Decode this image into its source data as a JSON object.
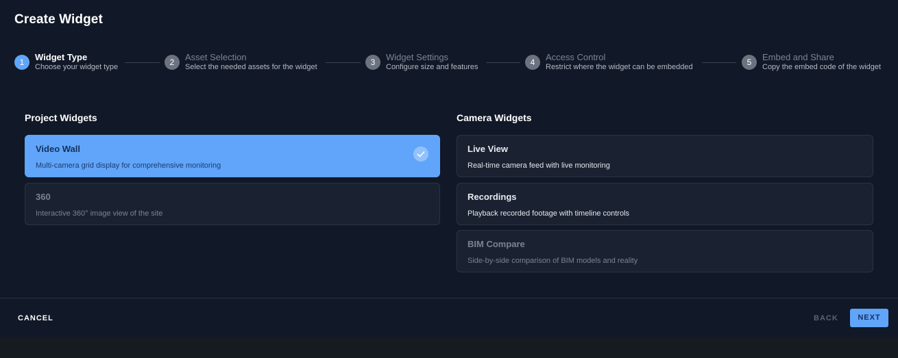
{
  "dialog": {
    "title": "Create Widget"
  },
  "stepper": {
    "steps": [
      {
        "number": "1",
        "title": "Widget Type",
        "subtitle": "Choose your widget type",
        "active": true
      },
      {
        "number": "2",
        "title": "Asset Selection",
        "subtitle": "Select the needed assets for the widget",
        "active": false
      },
      {
        "number": "3",
        "title": "Widget Settings",
        "subtitle": "Configure size and features",
        "active": false
      },
      {
        "number": "4",
        "title": "Access Control",
        "subtitle": "Restrict where the widget can be embedded",
        "active": false
      },
      {
        "number": "5",
        "title": "Embed and Share",
        "subtitle": "Copy the embed code of the widget",
        "active": false
      }
    ]
  },
  "project_widgets": {
    "heading": "Project Widgets",
    "cards": [
      {
        "title": "Video Wall",
        "description": "Multi-camera grid display for comprehensive monitoring",
        "state": "selected"
      },
      {
        "title": "360",
        "description": "Interactive 360° image view of the site",
        "state": "disabled"
      }
    ]
  },
  "camera_widgets": {
    "heading": "Camera Widgets",
    "cards": [
      {
        "title": "Live View",
        "description": "Real-time camera feed with live monitoring",
        "state": "enabled"
      },
      {
        "title": "Recordings",
        "description": "Playback recorded footage with timeline controls",
        "state": "enabled"
      },
      {
        "title": "BIM Compare",
        "description": "Side-by-side comparison of BIM models and reality",
        "state": "disabled"
      }
    ]
  },
  "footer": {
    "cancel_label": "CANCEL",
    "back_label": "BACK",
    "next_label": "NEXT"
  },
  "colors": {
    "accent": "#60a5fa",
    "background": "#111827",
    "card": "#1a2231"
  },
  "icons": {
    "selected_indicator": "check-icon"
  }
}
